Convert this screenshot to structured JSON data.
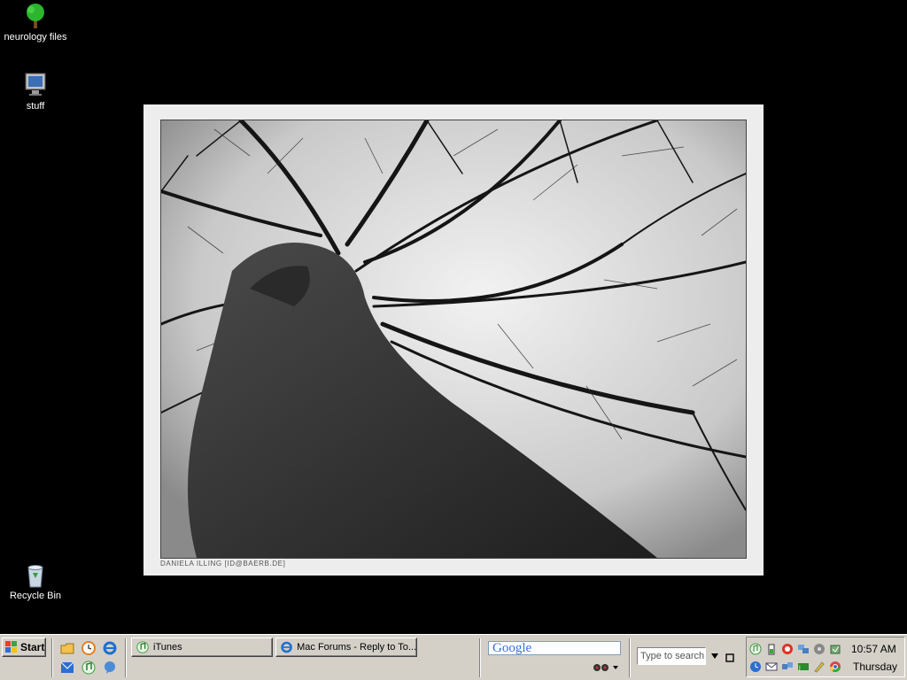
{
  "desktop": {
    "icons": [
      {
        "label": "neurology files",
        "icon": "tree-icon"
      },
      {
        "label": "stuff",
        "icon": "monitor-icon"
      },
      {
        "label": "Recycle Bin",
        "icon": "recycle-bin-icon"
      }
    ]
  },
  "wallpaper": {
    "caption": "DANIELA ILLING [ID@BAERB.DE]",
    "subject": "tree-photo"
  },
  "taskbar": {
    "start_label": "Start",
    "quick_launch": [
      "folder-icon",
      "clock-icon",
      "internet-explorer-icon",
      "outlook-icon",
      "itunes-icon",
      "messenger-icon"
    ],
    "tasks": [
      {
        "label": "iTunes",
        "icon": "itunes-icon"
      },
      {
        "label": "Mac Forums - Reply to To...",
        "icon": "internet-explorer-icon"
      }
    ],
    "google_toolbar": {
      "label": "Google"
    },
    "search": {
      "placeholder": "Type to search"
    },
    "tray_icons": [
      "itunes-icon",
      "battery-icon",
      "antivirus-icon",
      "network-icon",
      "speaker-icon",
      "update-icon",
      "clock-icon",
      "mail-icon",
      "network2-icon",
      "java-icon",
      "pen-icon",
      "chrome-icon"
    ],
    "clock": {
      "time": "10:57 AM",
      "day": "Thursday"
    }
  },
  "colors": {
    "desktop_bg": "#000000",
    "taskbar_bg": "#d4d0c8",
    "frame_bg": "#ededed"
  }
}
